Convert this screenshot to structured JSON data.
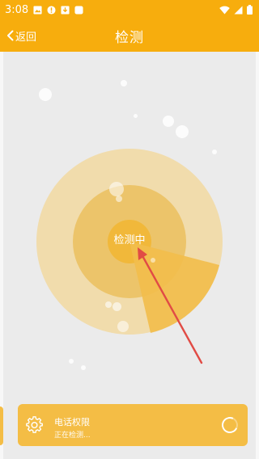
{
  "statusbar": {
    "time": "3:08",
    "left_icons": [
      "image-icon",
      "alert-circle-icon",
      "download-box-icon",
      "app-square-icon"
    ],
    "right_icons": [
      "wifi-icon",
      "signal-icon",
      "battery-icon"
    ]
  },
  "toolbar": {
    "back_label": "返回",
    "title": "检测"
  },
  "scanner": {
    "center_label": "检测中"
  },
  "card": {
    "title": "电话权限",
    "subtitle": "正在检测...",
    "icon": "gear-icon"
  },
  "colors": {
    "accent": "#f7ad0d",
    "panel_bg": "#ebebeb",
    "card_bg": "#f4bd45",
    "arrow": "#e14b45"
  }
}
